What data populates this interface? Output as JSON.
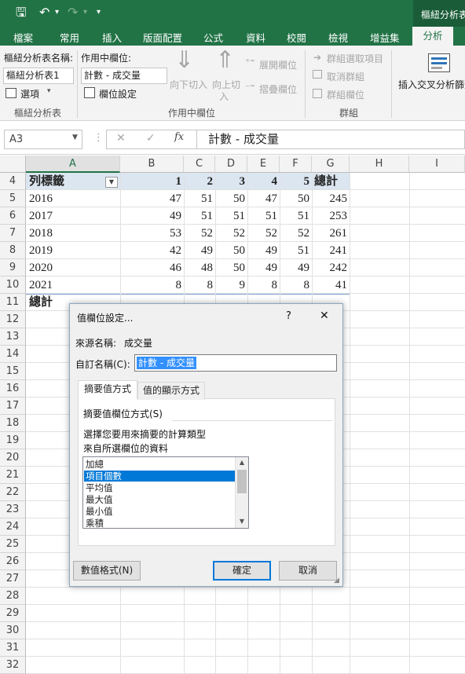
{
  "title": {
    "context": "樞紐分析表..."
  },
  "qat": {
    "save": "🖫",
    "undo": "↶",
    "undo_dd": "▾",
    "redo": "↷",
    "redo_dd": "▾",
    "customize": "▾"
  },
  "tabs": [
    "檔案",
    "常用",
    "插入",
    "版面配置",
    "公式",
    "資料",
    "校閱",
    "檢視",
    "增益集",
    "分析"
  ],
  "ribbon": {
    "pivot_name_label": "樞紐分析表名稱:",
    "pivot_name_value": "樞紐分析表1",
    "options_label": "選項",
    "group_pivot": "樞紐分析表",
    "active_field_label": "作用中欄位:",
    "active_field_value": "計數 - 成交量",
    "field_settings": "欄位設定",
    "drill_down": "向下切入",
    "drill_up_1": "向上切",
    "drill_up_2": "入",
    "expand_field": "展開欄位",
    "collapse_field": "摺疊欄位",
    "group_active": "作用中欄位",
    "group_selection": "群組選取項目",
    "ungroup": "取消群組",
    "group_field": "群組欄位",
    "group_group": "群組",
    "insert_slicer": "插入交叉分析篩選"
  },
  "formula": {
    "name_box": "A3",
    "cancel": "✕",
    "enter": "✓",
    "fx": "fx",
    "content": "計數 - 成交量"
  },
  "columns": [
    "A",
    "B",
    "C",
    "D",
    "E",
    "F",
    "G",
    "H",
    "I"
  ],
  "rows": [
    4,
    5,
    6,
    7,
    8,
    9,
    10,
    11,
    12,
    13,
    14,
    15,
    16,
    17,
    18,
    19,
    20,
    21,
    22,
    23,
    24,
    25,
    26,
    27,
    28,
    29,
    30,
    31,
    32
  ],
  "pivot": {
    "header": [
      "列標籤",
      "1",
      "2",
      "3",
      "4",
      "5",
      "總計"
    ],
    "data": [
      [
        "2016",
        "47",
        "51",
        "50",
        "47",
        "50",
        "245"
      ],
      [
        "2017",
        "49",
        "51",
        "51",
        "51",
        "51",
        "253"
      ],
      [
        "2018",
        "53",
        "52",
        "52",
        "52",
        "52",
        "261"
      ],
      [
        "2019",
        "42",
        "49",
        "50",
        "49",
        "51",
        "241"
      ],
      [
        "2020",
        "46",
        "48",
        "50",
        "49",
        "49",
        "242"
      ],
      [
        "2021",
        "8",
        "8",
        "9",
        "8",
        "8",
        "41"
      ]
    ],
    "total_label": "總計"
  },
  "dialog": {
    "title": "值欄位設定...",
    "help": "?",
    "close": "✕",
    "source_label": "來源名稱:",
    "source_value": "成交量",
    "custom_label": "自訂名稱(C):",
    "custom_value": "計數 - 成交量",
    "tab_summarize": "摘要值方式",
    "tab_show": "值的顯示方式",
    "section": "摘要值欄位方式(S)",
    "desc1": "選擇您要用來摘要的計算類型",
    "desc2": "來自所選欄位的資料",
    "list": [
      "加總",
      "項目個數",
      "平均值",
      "最大值",
      "最小值",
      "乘積"
    ],
    "selected_index": 1,
    "number_format": "數值格式(N)",
    "ok": "確定",
    "cancel": "取消"
  }
}
